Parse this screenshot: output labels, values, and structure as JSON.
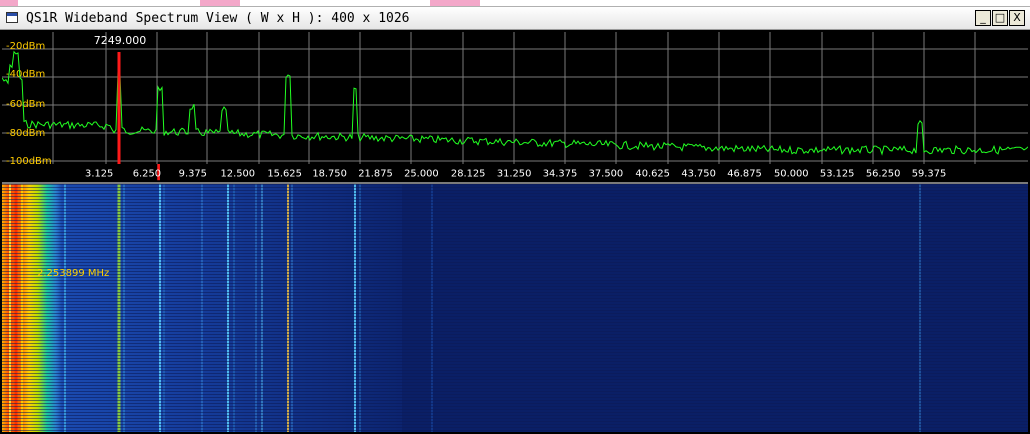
{
  "window": {
    "title": "QS1R Wideband Spectrum View ( W x H ): 400 x 1026",
    "icon": "app-window-icon",
    "buttons": {
      "minimize": "_",
      "maximize": "□",
      "close": "X"
    }
  },
  "spectrum": {
    "db_labels": [
      "-20dBm",
      "-40dBm",
      "-60dBm",
      "-80dBm",
      "-100dBm"
    ],
    "marker_frequency": "7249.000",
    "freq_labels": [
      "3.125",
      "6.250",
      "9.375",
      "12.500",
      "15.625",
      "18.750",
      "21.875",
      "25.000",
      "28.125",
      "31.250",
      "34.375",
      "37.500",
      "40.625",
      "43.750",
      "46.875",
      "50.000",
      "53.125",
      "56.250",
      "59.375"
    ],
    "colors": {
      "trace": "#22ff22",
      "grid": "#7a7a7a",
      "marker": "#ff1a1a",
      "db_label": "#ffcc00",
      "background": "#000000"
    }
  },
  "waterfall": {
    "cursor_readout": "2.253899 MHz",
    "colors": {
      "base": "#0a1f66",
      "hot": "#ff4a00",
      "warm": "#ffd200",
      "mid": "#19c8c8"
    }
  }
}
